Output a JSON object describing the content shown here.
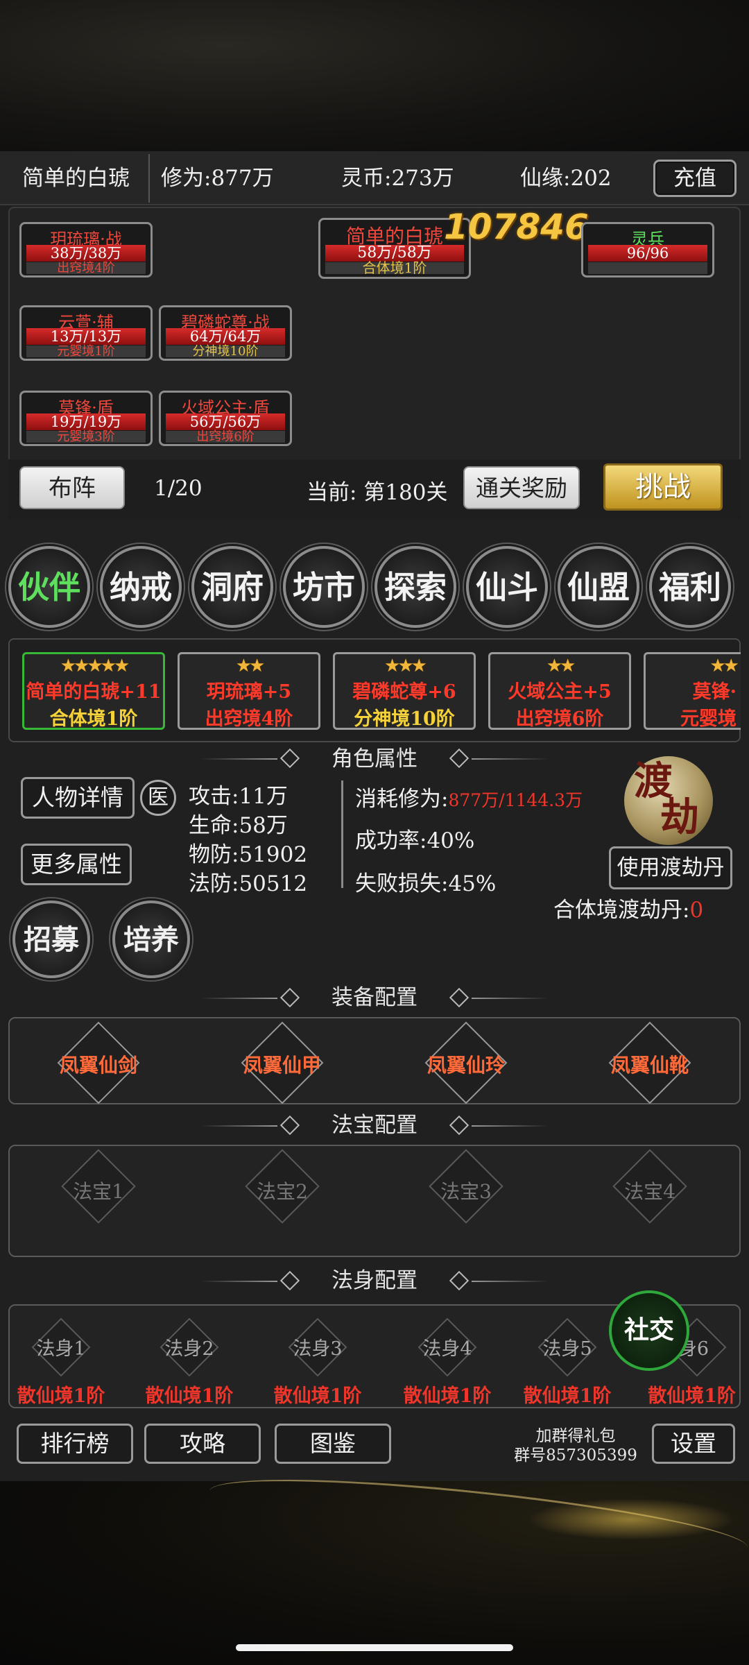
{
  "header": {
    "player_name": "简单的白琥",
    "cultivation": "修为:877万",
    "spirit_coin": "灵币:273万",
    "fate": "仙缘:202",
    "recharge_label": "充值"
  },
  "battle": {
    "power_score": "107846",
    "leader": {
      "name": "简单的白琥",
      "hp": "58万/58万",
      "rank": "合体境1阶"
    },
    "spirit_soldier": {
      "name": "灵兵",
      "hp": "96/96"
    },
    "allies": [
      {
        "name": "玥琉璃·战",
        "hp": "38万/38万",
        "rank": "出窍境4阶"
      },
      {
        "name": "云萱·辅",
        "hp": "13万/13万",
        "rank": "元婴境1阶"
      },
      {
        "name": "碧磷蛇尊·战",
        "hp": "64万/64万",
        "rank": "分神境10阶"
      },
      {
        "name": "莫锋·盾",
        "hp": "19万/19万",
        "rank": "元婴境3阶"
      },
      {
        "name": "火域公主·盾",
        "hp": "56万/56万",
        "rank": "出窍境6阶"
      }
    ],
    "formation_label": "布阵",
    "formation_count": "1/20",
    "current_stage": "当前: 第180关",
    "clear_reward_label": "通关奖励",
    "challenge_label": "挑战"
  },
  "tabs": [
    "伙伴",
    "纳戒",
    "洞府",
    "坊市",
    "探索",
    "仙斗",
    "仙盟",
    "福利"
  ],
  "partners": [
    {
      "stars": "★★★★★",
      "name": "简单的白琥+11",
      "rank": "合体境1阶"
    },
    {
      "stars": "★★",
      "name": "玥琉璃+5",
      "rank": "出窍境4阶"
    },
    {
      "stars": "★★★",
      "name": "碧磷蛇尊+6",
      "rank": "分神境10阶"
    },
    {
      "stars": "★★",
      "name": "火域公主+5",
      "rank": "出窍境6阶"
    },
    {
      "stars": "★★",
      "name": "莫锋·",
      "rank": "元婴境"
    }
  ],
  "attributes": {
    "section_title": "角色属性",
    "detail_label": "人物详情",
    "heal_label": "医",
    "more_label": "更多属性",
    "attack": "攻击:11万",
    "hp": "生命:58万",
    "phys_def": "物防:51902",
    "magic_def": "法防:50512",
    "consume_label": "消耗修为:",
    "consume_value": "877万/1144.3万",
    "success_rate": "成功率:40%",
    "fail_loss": "失败损失:45%",
    "tribulation_badge": "渡劫",
    "use_pill_label": "使用渡劫丹",
    "pill_label": "合体境渡劫丹:",
    "pill_count": "0",
    "recruit_label": "招募",
    "train_label": "培养"
  },
  "equipment": {
    "section_title": "装备配置",
    "items": [
      "凤翼仙剑",
      "凤翼仙甲",
      "凤翼仙玲",
      "凤翼仙靴"
    ]
  },
  "treasures": {
    "section_title": "法宝配置",
    "items": [
      "法宝1",
      "法宝2",
      "法宝3",
      "法宝4"
    ]
  },
  "bodies": {
    "section_title": "法身配置",
    "items": [
      {
        "name": "法身1",
        "rank": "散仙境1阶"
      },
      {
        "name": "法身2",
        "rank": "散仙境1阶"
      },
      {
        "name": "法身3",
        "rank": "散仙境1阶"
      },
      {
        "name": "法身4",
        "rank": "散仙境1阶"
      },
      {
        "name": "法身5",
        "rank": "散仙境1阶"
      },
      {
        "name": "身6",
        "rank": "散仙境1阶"
      }
    ],
    "social_label": "社交"
  },
  "footer": {
    "rank_label": "排行榜",
    "guide_label": "攻略",
    "codex_label": "图鉴",
    "group_line1": "加群得礼包",
    "group_line2": "群号857305399",
    "settings_label": "设置"
  }
}
